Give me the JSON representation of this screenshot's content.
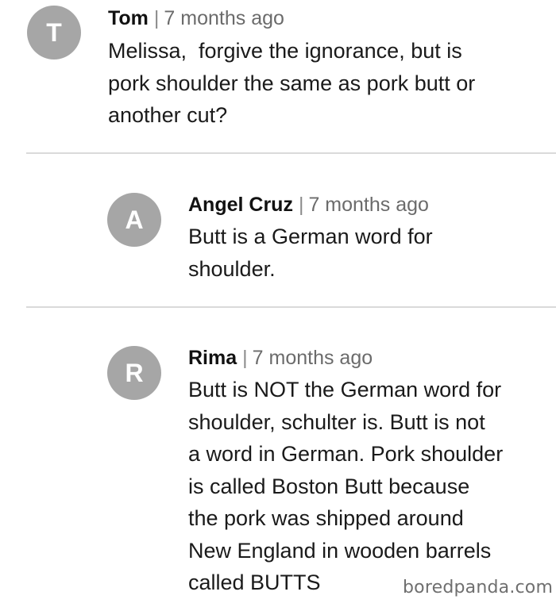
{
  "comments": [
    {
      "avatar_letter": "T",
      "author": "Tom",
      "separator": "|",
      "time": "7 months ago",
      "lines": [
        "Melissa,  forgive the ignorance, but is",
        "pork shoulder the same as pork butt or",
        "another cut?"
      ]
    },
    {
      "avatar_letter": "A",
      "author": "Angel Cruz",
      "separator": "|",
      "time": "7 months ago",
      "lines": [
        "Butt is a German word for",
        "shoulder."
      ]
    },
    {
      "avatar_letter": "R",
      "author": "Rima",
      "separator": "|",
      "time": "7 months ago",
      "lines": [
        "Butt is NOT the German word for",
        "shoulder, schulter is. Butt is not",
        "a word in German. Pork shoulder",
        "is called Boston Butt because",
        "the pork was shipped around",
        "New England in wooden barrels",
        "called BUTTS"
      ]
    }
  ],
  "watermark": "boredpanda.com",
  "colors": {
    "avatar_bg": "#a6a6a6",
    "divider": "#dadada",
    "meta_gray": "#6b6b6b"
  }
}
